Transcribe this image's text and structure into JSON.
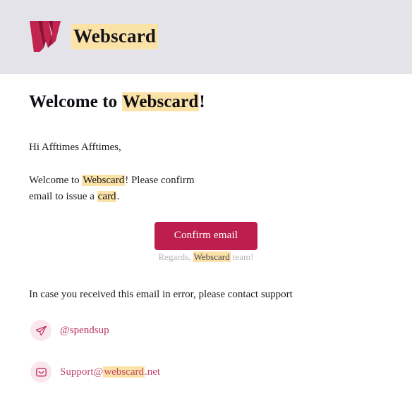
{
  "header": {
    "logo_icon": "webscard-w-logo",
    "brand_name": "Webscard",
    "background_color": "#e4e3e9",
    "logo_color_light": "#c0244f",
    "logo_color_dark": "#8c1235"
  },
  "main": {
    "headline_prefix": "Welcome to ",
    "headline_brand": "Webscard",
    "headline_suffix": "!",
    "greeting": "Hi Afftimes Afftimes,",
    "intro_part1": "Welcome to ",
    "intro_brand": "Webscard",
    "intro_part2": "! Please confirm email to issue a ",
    "intro_highlight": "card",
    "intro_part3": ".",
    "cta_label": "Confirm email",
    "cta_color": "#be1e4d",
    "regards_prefix": "Regards, ",
    "regards_brand": "Webscard",
    "regards_suffix": " team!",
    "error_note": "In case you received this email in error, please contact support"
  },
  "contacts": [
    {
      "icon": "paper-plane-icon",
      "label": "@spendsup",
      "icon_color": "#c83a63",
      "icon_bg": "#fae7ee"
    },
    {
      "icon": "envelope-icon",
      "label_prefix": "Support@",
      "label_highlight": "webscard",
      "label_suffix": ".net",
      "icon_color": "#bb3059",
      "icon_bg": "#fae7ee"
    }
  ],
  "theme": {
    "highlight_color": "#fbe2a7",
    "accent_color": "#be1e4d",
    "text_color": "#1d1b21",
    "muted_text_color": "#b4b0b8"
  }
}
